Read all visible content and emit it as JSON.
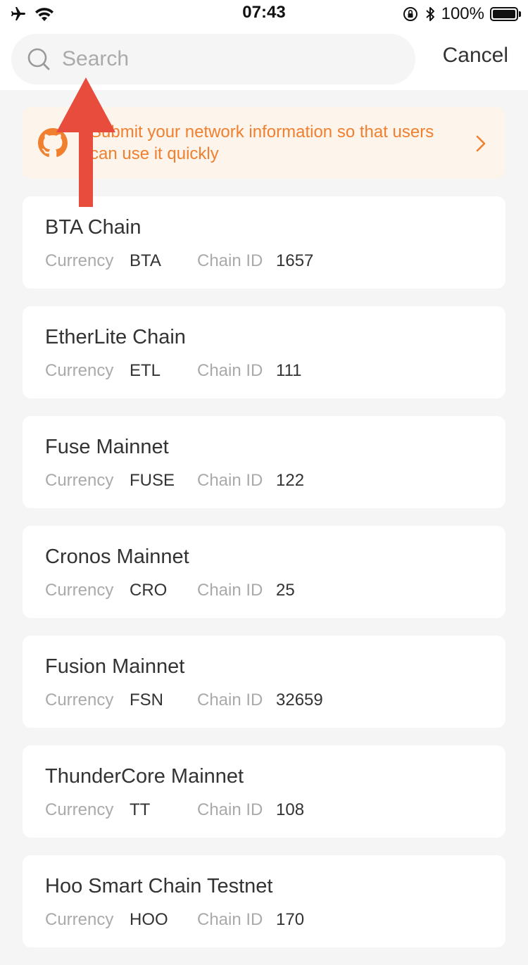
{
  "status_bar": {
    "time": "07:43",
    "battery": "100%"
  },
  "search": {
    "placeholder": "Search",
    "value": "",
    "cancel_label": "Cancel"
  },
  "banner": {
    "text": "Submit your network information so that users can use it quickly"
  },
  "meta_labels": {
    "currency": "Currency",
    "chain_id": "Chain ID"
  },
  "networks": [
    {
      "name": "BTA Chain",
      "currency": "BTA",
      "chain_id": "1657"
    },
    {
      "name": "EtherLite Chain",
      "currency": "ETL",
      "chain_id": "111"
    },
    {
      "name": "Fuse Mainnet",
      "currency": "FUSE",
      "chain_id": "122"
    },
    {
      "name": "Cronos Mainnet",
      "currency": "CRO",
      "chain_id": "25"
    },
    {
      "name": "Fusion Mainnet",
      "currency": "FSN",
      "chain_id": "32659"
    },
    {
      "name": "ThunderCore Mainnet",
      "currency": "TT",
      "chain_id": "108"
    },
    {
      "name": "Hoo Smart Chain Testnet",
      "currency": "HOO",
      "chain_id": "170"
    }
  ],
  "colors": {
    "accent_orange": "#f0802f",
    "banner_background": "#fdf4ec",
    "annotation_arrow": "#e84c3d"
  }
}
